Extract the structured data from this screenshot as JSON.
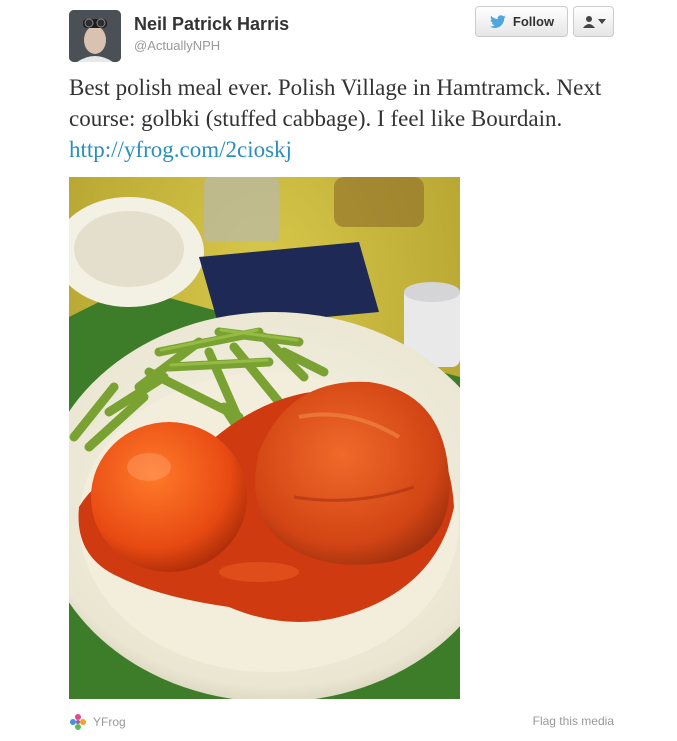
{
  "author": {
    "name": "Neil Patrick Harris",
    "handle": "@ActuallyNPH"
  },
  "actions": {
    "follow_label": "Follow"
  },
  "tweet": {
    "text": "Best polish meal ever. Polish Village in Hamtramck. Next course: golbki (stuffed cabbage). I feel like Bourdain.",
    "link": "http://yfrog.com/2cioskj"
  },
  "footer": {
    "provider": "YFrog",
    "flag_label": "Flag this media"
  },
  "colors": {
    "link": "#2a8fbd",
    "twitter_bird": "#4ea8de"
  }
}
